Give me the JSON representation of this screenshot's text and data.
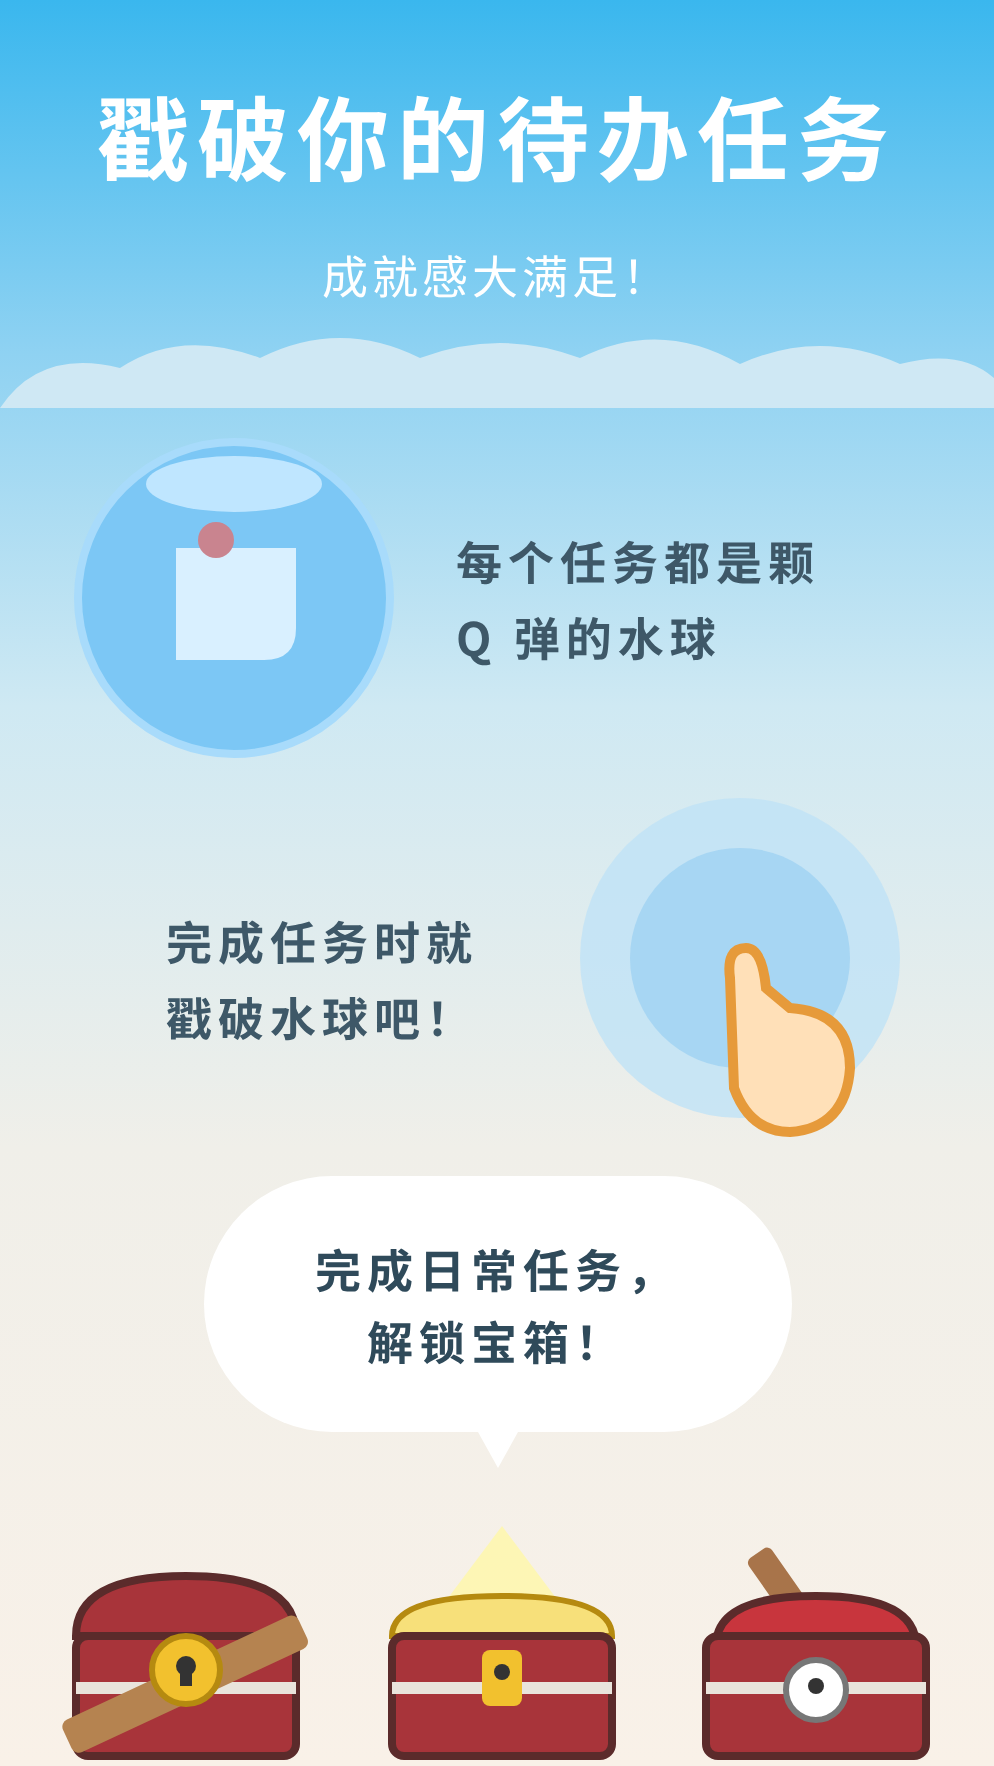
{
  "title": "戳破你的待办任务",
  "subtitle": "成就感大满足！",
  "features": [
    {
      "kind": "bubble",
      "lines": [
        "每个任务都是颗",
        "Q 弹的水球"
      ]
    },
    {
      "kind": "splash",
      "lines": [
        "完成任务时就",
        "戳破水球吧！"
      ]
    }
  ],
  "speech": {
    "lines": [
      "完成日常任务，",
      "解锁宝箱！"
    ]
  },
  "chests": [
    {
      "kind": "locked"
    },
    {
      "kind": "glowing"
    },
    {
      "kind": "opened"
    }
  ]
}
